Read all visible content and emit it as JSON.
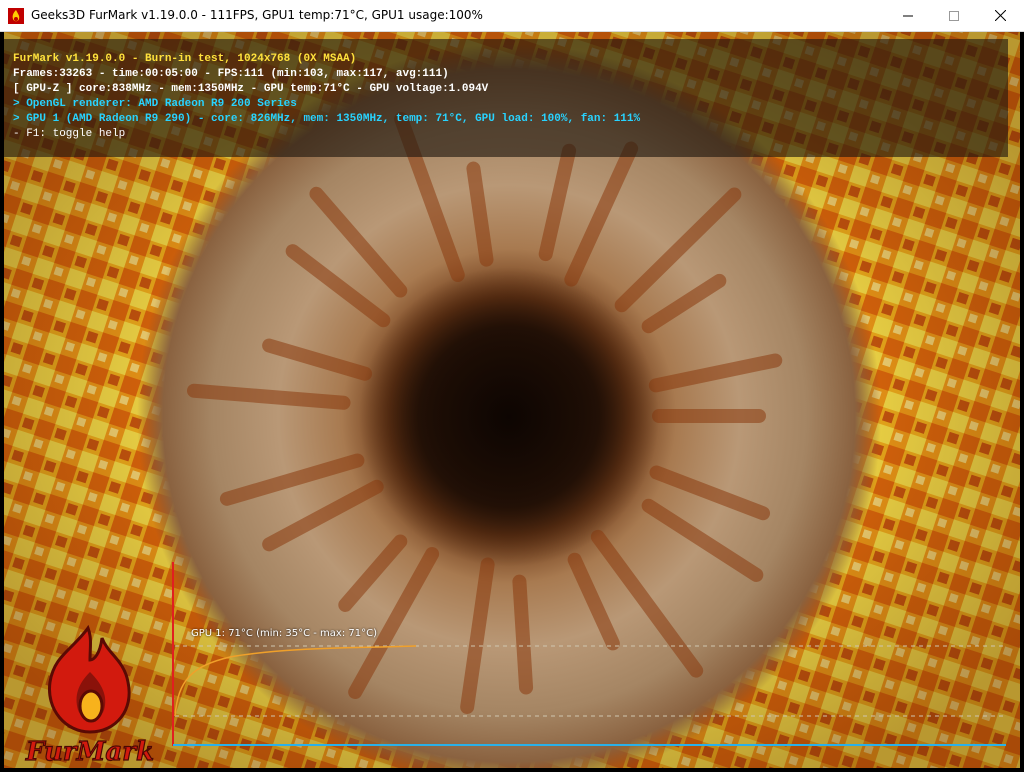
{
  "window": {
    "title": "Geeks3D FurMark v1.19.0.0 - 111FPS, GPU1 temp:71°C, GPU1 usage:100%",
    "app_icon": "furmark-flame-icon",
    "controls": [
      "minimize-icon",
      "maximize-icon",
      "close-icon"
    ]
  },
  "hud": {
    "line1": "FurMark v1.19.0.0 - Burn-in test, 1024x768 (0X MSAA)",
    "line2": "Frames:33263 - time:00:05:00 - FPS:111 (min:103, max:117, avg:111)",
    "line3": "[ GPU-Z ] core:838MHz - mem:1350MHz - GPU temp:71°C - GPU voltage:1.094V",
    "line4": "> OpenGL renderer: AMD Radeon R9 200 Series",
    "line5": "> GPU 1 (AMD Radeon R9 290) - core: 826MHz, mem: 1350MHz, temp: 71°C, GPU load: 100%, fan: 111%",
    "line6": "- F1: toggle help"
  },
  "graph": {
    "label": "GPU 1: 71°C (min: 35°C - max: 71°C)",
    "min_temp": 35,
    "max_temp": 71,
    "line_color": "#f0a02a",
    "axis_color": "#2ab0e8",
    "y_axis_color": "#e02020"
  },
  "logo": {
    "text": "FurMark",
    "icon": "furmark-flame-logo"
  },
  "colors": {
    "hud_title": "#ffe23c",
    "hud_info": "#28d3ff",
    "hud_text": "#ffffff"
  }
}
